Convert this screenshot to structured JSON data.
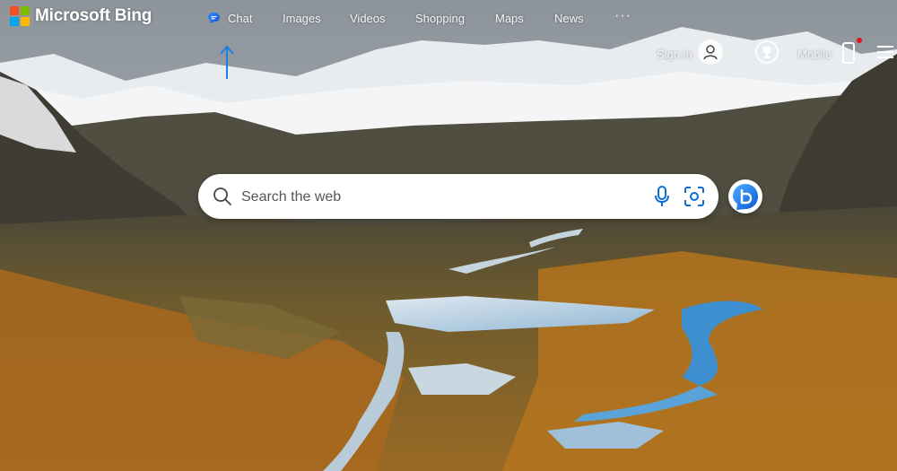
{
  "brand": {
    "name": "Microsoft Bing",
    "logo_colors": [
      "#f25022",
      "#7fba00",
      "#00a4ef",
      "#ffb900"
    ]
  },
  "nav": {
    "items": [
      {
        "label": "Chat",
        "icon": "chat-bubble-icon"
      },
      {
        "label": "Images"
      },
      {
        "label": "Videos"
      },
      {
        "label": "Shopping"
      },
      {
        "label": "Maps"
      },
      {
        "label": "News"
      }
    ],
    "more_label": "···"
  },
  "top_right": {
    "signin_label": "Sign in",
    "avatar_icon": "person-icon",
    "rewards_icon": "trophy-icon",
    "mobile_label": "Mobile",
    "mobile_icon": "phone-icon",
    "menu_icon": "hamburger-icon"
  },
  "search": {
    "placeholder": "Search the web",
    "value": "",
    "voice_icon": "microphone-icon",
    "visual_icon": "visual-search-icon"
  },
  "copilot": {
    "icon": "copilot-b-icon"
  },
  "colors": {
    "accent": "#0c6dd6",
    "arrow": "#1a7fe6",
    "notification": "#e81123"
  }
}
